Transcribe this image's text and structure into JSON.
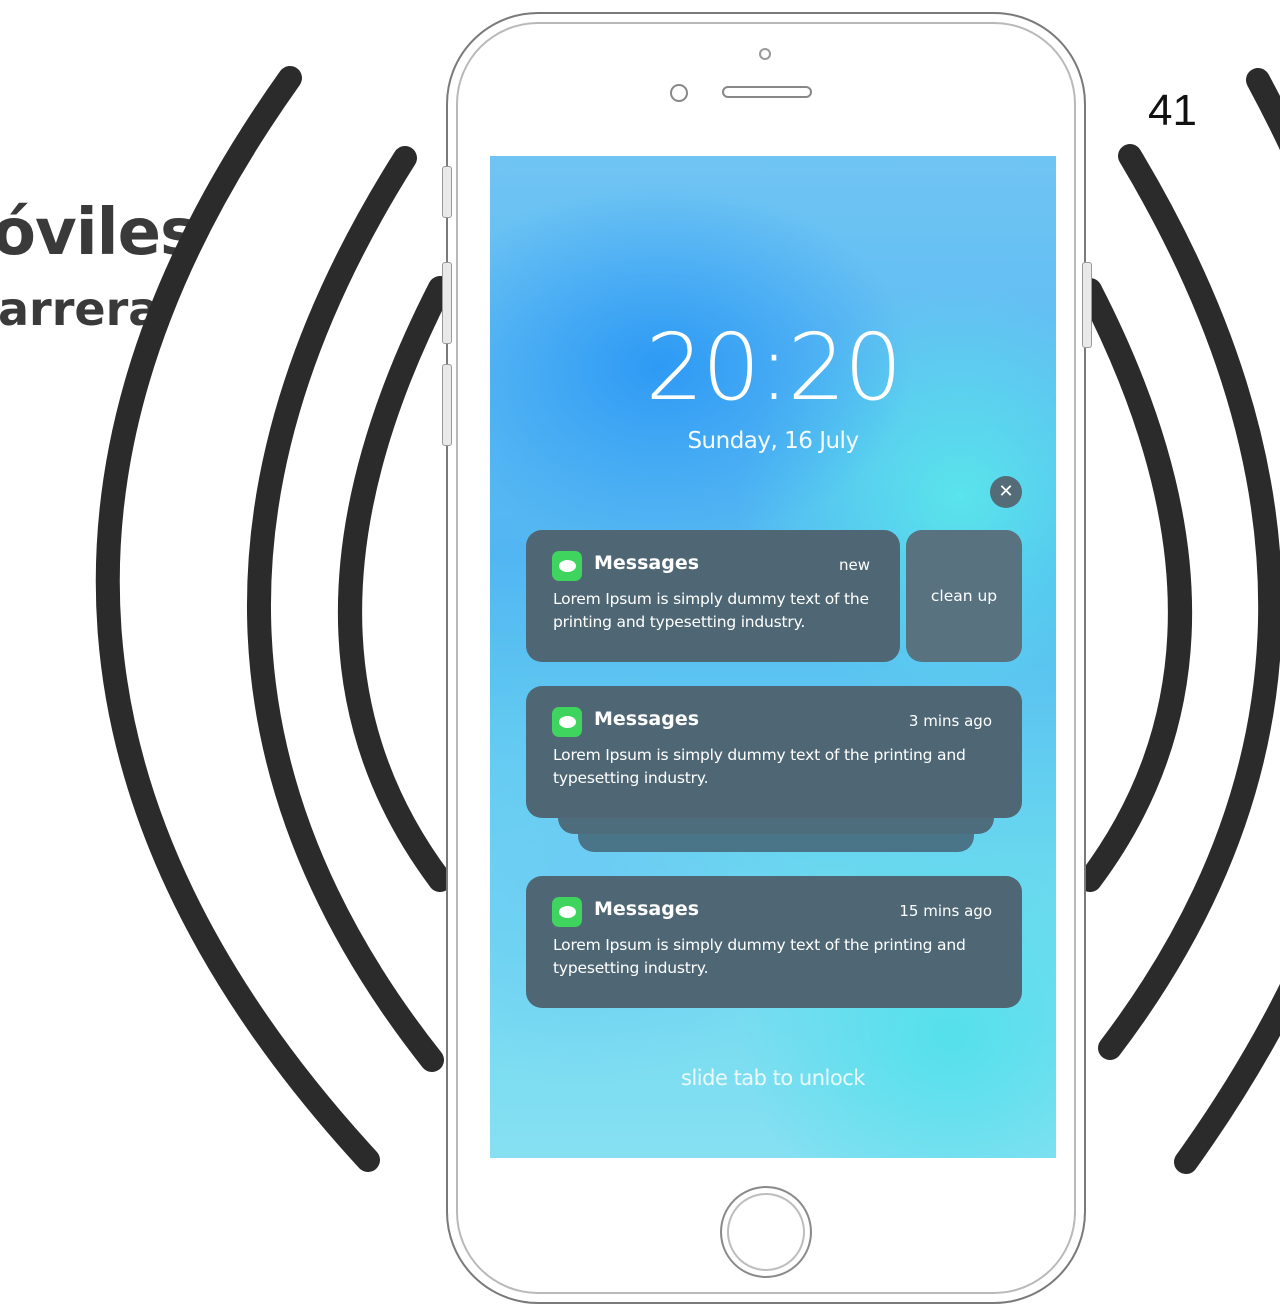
{
  "slide": {
    "title": "óviles",
    "subtitle": "arrera",
    "page_number": "41"
  },
  "lockscreen": {
    "time": "20:20",
    "date": "Sunday, 16 July",
    "dismiss_icon": "close-icon",
    "cleanup_label": "clean up",
    "unlock_hint": "slide tab to unlock",
    "notifications": [
      {
        "app": "Messages",
        "time": "new",
        "body_line1": "Lorem Ipsum is simply dummy text of the",
        "body_line2": "printing and typesetting industry."
      },
      {
        "app": "Messages",
        "time": "3 mins ago",
        "body_line1": "Lorem Ipsum is simply dummy text of the printing and",
        "body_line2": "typesetting industry."
      },
      {
        "app": "Messages",
        "time": "15 mins ago",
        "body_line1": "Lorem Ipsum is simply dummy text of the printing and",
        "body_line2": "typesetting industry."
      }
    ]
  },
  "colors": {
    "card": "#4f6774",
    "app_icon": "#3ed45d",
    "wave": "#2b2b2b"
  }
}
